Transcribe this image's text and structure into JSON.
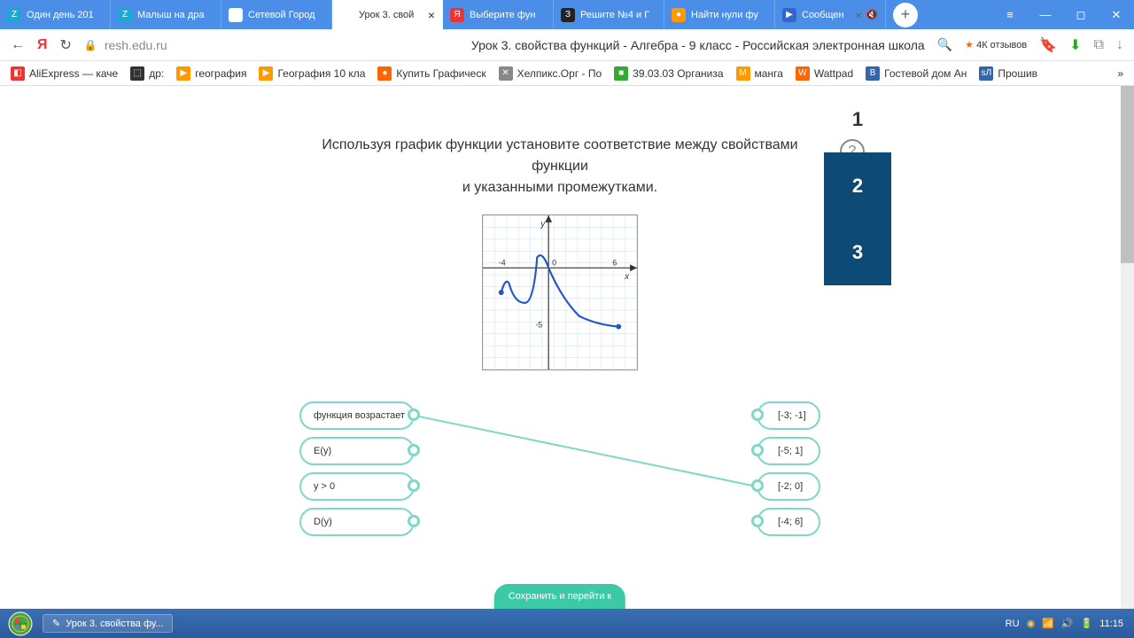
{
  "tabs": [
    {
      "icon": "Z",
      "iconBg": "#1ba8d4",
      "label": "Один день 201"
    },
    {
      "icon": "Z",
      "iconBg": "#1ba8d4",
      "label": "Малыш на дра"
    },
    {
      "icon": "■",
      "iconBg": "#fff",
      "label": "Сетевой Город"
    },
    {
      "icon": "✎",
      "iconBg": "#fff",
      "label": "Урок 3. свой",
      "active": true
    },
    {
      "icon": "Я",
      "iconBg": "#e33",
      "label": "Выберите фун"
    },
    {
      "icon": "З",
      "iconBg": "#222",
      "label": "Решите №4 и Г"
    },
    {
      "icon": "●",
      "iconBg": "#f90",
      "label": "Найти нули фу"
    },
    {
      "icon": "▶",
      "iconBg": "#36c",
      "label": "Сообщен"
    }
  ],
  "url": {
    "domain": "resh.edu.ru"
  },
  "pageTitle": "Урок 3. свойства функций - Алгебра - 9 класс - Российская электронная школа",
  "reviews": "4К отзывов",
  "bookmarks": [
    {
      "icon": "◧",
      "iconBg": "#e33",
      "label": "AliExpress — каче"
    },
    {
      "icon": "⬚",
      "iconBg": "#333",
      "label": "др:"
    },
    {
      "icon": "▶",
      "iconBg": "#f90",
      "label": "география"
    },
    {
      "icon": "▶",
      "iconBg": "#f90",
      "label": "География 10 кла"
    },
    {
      "icon": "●",
      "iconBg": "#f60",
      "label": "Купить Графическ"
    },
    {
      "icon": "✕",
      "iconBg": "#888",
      "label": "Хелпикс.Орг - По"
    },
    {
      "icon": "■",
      "iconBg": "#3a3",
      "label": "39.03.03 Организа"
    },
    {
      "icon": "M",
      "iconBg": "#f90",
      "label": "манга"
    },
    {
      "icon": "W",
      "iconBg": "#f60",
      "label": "Wattpad"
    },
    {
      "icon": "B",
      "iconBg": "#36a",
      "label": "Гостевой дом Ан"
    },
    {
      "icon": "sЛ",
      "iconBg": "#36a",
      "label": "Прошив"
    }
  ],
  "question": {
    "line1": "Используя график функции установите соответствие между свойствами функции",
    "line2": "и указанными промежутками."
  },
  "chart_data": {
    "type": "line",
    "title": "",
    "xlabel": "x",
    "ylabel": "y",
    "xlim": [
      -5,
      8
    ],
    "ylim": [
      -7,
      5
    ],
    "xticks": [
      -4,
      0,
      6
    ],
    "yticks": [
      -5,
      0
    ],
    "points": [
      {
        "x": -4,
        "y": -2.2
      },
      {
        "x": -3.5,
        "y": -1
      },
      {
        "x": -3,
        "y": -2
      },
      {
        "x": -2.5,
        "y": -3
      },
      {
        "x": -2,
        "y": -2
      },
      {
        "x": -1.5,
        "y": 0
      },
      {
        "x": -1,
        "y": 1
      },
      {
        "x": -0.5,
        "y": 1.3
      },
      {
        "x": 0,
        "y": 0
      },
      {
        "x": 1,
        "y": -2
      },
      {
        "x": 2,
        "y": -3.2
      },
      {
        "x": 3,
        "y": -4
      },
      {
        "x": 4,
        "y": -4.5
      },
      {
        "x": 5,
        "y": -4.8
      },
      {
        "x": 6,
        "y": -5
      }
    ]
  },
  "leftItems": [
    {
      "label": "функция возрастает"
    },
    {
      "label": "E(y)"
    },
    {
      "label": "y > 0"
    },
    {
      "label": "D(y)"
    }
  ],
  "rightItems": [
    {
      "label": "[-3; -1]"
    },
    {
      "label": "[-5; 1]"
    },
    {
      "label": "[-2; 0]"
    },
    {
      "label": "[-4; 6]"
    }
  ],
  "connections": [
    {
      "from": 0,
      "to": 2
    }
  ],
  "sideNums": [
    "1",
    "2",
    "3"
  ],
  "sideActive": 1,
  "saveBtn": "Сохранить и перейти к",
  "taskbarItem": "Урок 3. свойства фу...",
  "tray": {
    "lang": "RU",
    "time": "11:15"
  }
}
